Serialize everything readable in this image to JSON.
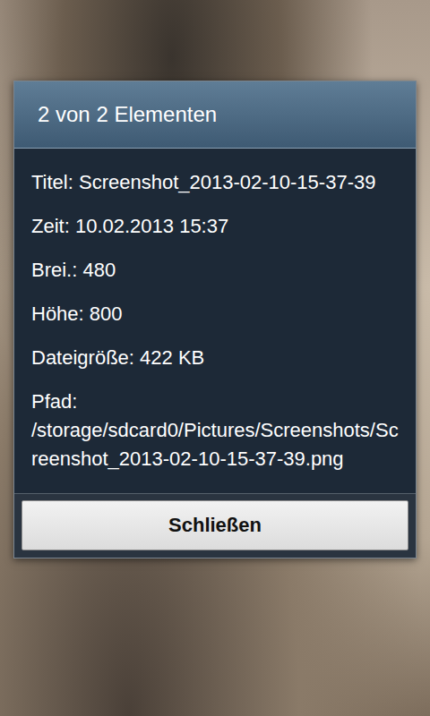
{
  "dialog": {
    "title": "2 von 2 Elementen",
    "fields": [
      {
        "label": "Titel:",
        "value": "Screenshot_2013-02-10-15-37-39"
      },
      {
        "label": "Zeit:",
        "value": "10.02.2013 15:37"
      },
      {
        "label": "Brei.:",
        "value": "480"
      },
      {
        "label": "Höhe:",
        "value": "800"
      },
      {
        "label": "Dateigröße:",
        "value": "422 KB"
      },
      {
        "label": "Pfad:",
        "value": "/storage/sdcard0/Pictures/Screenshots/Screenshot_2013-02-10-15-37-39.png"
      }
    ],
    "buttons": [
      "Schließen"
    ]
  }
}
